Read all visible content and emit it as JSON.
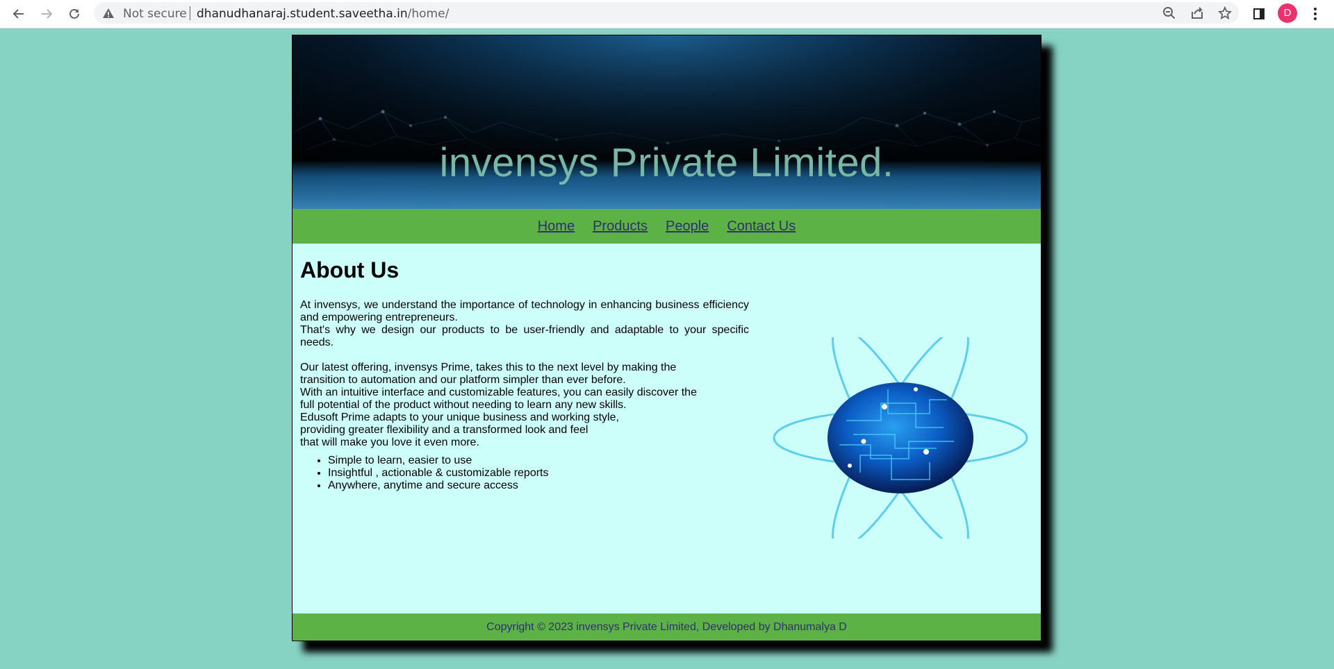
{
  "browser": {
    "security_label": "Not secure",
    "url_host": "dhanudhanaraj.student.saveetha.in",
    "url_path": "/home/",
    "avatar_letter": "D",
    "icons": [
      "back-icon",
      "forward-icon",
      "reload-icon",
      "warning-icon",
      "zoom-icon",
      "share-icon",
      "star-icon",
      "side-panel-icon",
      "menu-icon"
    ],
    "colors": {
      "avatar": "#e8336f",
      "omnibox": "#f1f3f4"
    }
  },
  "site": {
    "title": "invensys Private Limited.",
    "nav": [
      {
        "label": "Home"
      },
      {
        "label": "Products"
      },
      {
        "label": "People"
      },
      {
        "label": "Contact Us"
      }
    ],
    "heading": "About Us",
    "intro": [
      "At invensys, we understand the importance of technology in enhancing business efficiency and empowering entrepreneurs.",
      "That's why we design our products to be user-friendly and adaptable to your specific needs."
    ],
    "offering_lines": [
      "Our latest offering, invensys Prime, takes this to the next level by making the",
      "transition to automation and our platform simpler than ever before.",
      "With an intuitive interface and customizable features, you can easily discover the",
      "full potential of the product without needing to learn any new skills.",
      "Edusoft Prime adapts to your unique business and working style,",
      "providing greater flexibility and a transformed look and feel",
      "that will make you love it even more."
    ],
    "features": [
      "Simple to learn, easier to use",
      "Insightful , actionable & customizable reports",
      "Anywhere, anytime and secure access"
    ],
    "footer": "Copyright © 2023 invensys Private Limited, Developed by Dhanumalya D",
    "colors": {
      "background": "#86d3c4",
      "content_bg": "#ccfffa",
      "nav_bg": "#5cb245",
      "link": "#2f2f74",
      "title": "#78b7a8"
    }
  }
}
